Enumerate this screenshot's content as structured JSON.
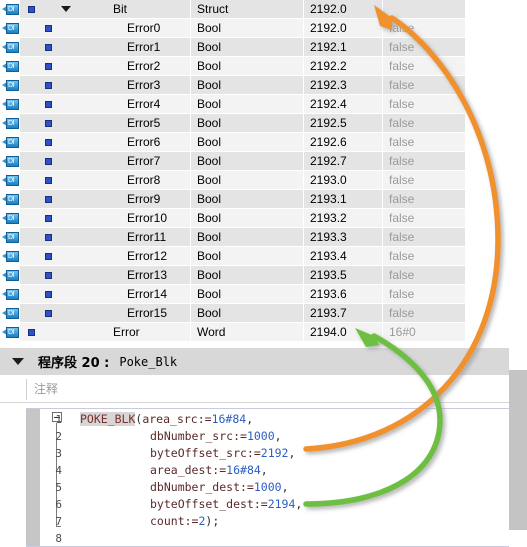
{
  "table": {
    "columns": [
      "icon",
      "marker",
      "name",
      "type",
      "offset",
      "value"
    ],
    "rows": [
      {
        "icon": "tag-icon",
        "level": 1,
        "expander": "collapse-triangle",
        "name": "Bit",
        "type": "Struct",
        "offset": "2192.0",
        "value": "",
        "shade": "norm"
      },
      {
        "icon": "tag-icon",
        "level": 2,
        "name": "Error0",
        "type": "Bool",
        "offset": "2192.0",
        "value": "false",
        "shade": "alt"
      },
      {
        "icon": "tag-icon",
        "level": 2,
        "name": "Error1",
        "type": "Bool",
        "offset": "2192.1",
        "value": "false",
        "shade": "norm"
      },
      {
        "icon": "tag-icon",
        "level": 2,
        "name": "Error2",
        "type": "Bool",
        "offset": "2192.2",
        "value": "false",
        "shade": "alt"
      },
      {
        "icon": "tag-icon",
        "level": 2,
        "name": "Error3",
        "type": "Bool",
        "offset": "2192.3",
        "value": "false",
        "shade": "norm"
      },
      {
        "icon": "tag-icon",
        "level": 2,
        "name": "Error4",
        "type": "Bool",
        "offset": "2192.4",
        "value": "false",
        "shade": "alt"
      },
      {
        "icon": "tag-icon",
        "level": 2,
        "name": "Error5",
        "type": "Bool",
        "offset": "2192.5",
        "value": "false",
        "shade": "norm"
      },
      {
        "icon": "tag-icon",
        "level": 2,
        "name": "Error6",
        "type": "Bool",
        "offset": "2192.6",
        "value": "false",
        "shade": "alt"
      },
      {
        "icon": "tag-icon",
        "level": 2,
        "name": "Error7",
        "type": "Bool",
        "offset": "2192.7",
        "value": "false",
        "shade": "norm"
      },
      {
        "icon": "tag-icon",
        "level": 2,
        "name": "Error8",
        "type": "Bool",
        "offset": "2193.0",
        "value": "false",
        "shade": "alt"
      },
      {
        "icon": "tag-icon",
        "level": 2,
        "name": "Error9",
        "type": "Bool",
        "offset": "2193.1",
        "value": "false",
        "shade": "norm"
      },
      {
        "icon": "tag-icon",
        "level": 2,
        "name": "Error10",
        "type": "Bool",
        "offset": "2193.2",
        "value": "false",
        "shade": "alt"
      },
      {
        "icon": "tag-icon",
        "level": 2,
        "name": "Error11",
        "type": "Bool",
        "offset": "2193.3",
        "value": "false",
        "shade": "norm"
      },
      {
        "icon": "tag-icon",
        "level": 2,
        "name": "Error12",
        "type": "Bool",
        "offset": "2193.4",
        "value": "false",
        "shade": "alt"
      },
      {
        "icon": "tag-icon",
        "level": 2,
        "name": "Error13",
        "type": "Bool",
        "offset": "2193.5",
        "value": "false",
        "shade": "norm"
      },
      {
        "icon": "tag-icon",
        "level": 2,
        "name": "Error14",
        "type": "Bool",
        "offset": "2193.6",
        "value": "false",
        "shade": "alt"
      },
      {
        "icon": "tag-icon",
        "level": 2,
        "name": "Error15",
        "type": "Bool",
        "offset": "2193.7",
        "value": "false",
        "shade": "norm"
      },
      {
        "icon": "tag-icon",
        "level": 1,
        "name": "Error",
        "type": "Word",
        "offset": "2194.0",
        "value": "16#0",
        "shade": "alt"
      }
    ]
  },
  "network": {
    "expander_icon": "collapse-triangle-icon",
    "title": "程序段 20 :",
    "name": "Poke_Blk",
    "comment_placeholder": "注释"
  },
  "code": {
    "lines": [
      {
        "no": "1",
        "segments": [
          {
            "t": "POKE_BLK",
            "c": "kw"
          },
          {
            "t": "(",
            "c": "pun"
          },
          {
            "t": "area_src:=",
            "c": "parm"
          },
          {
            "t": "16#84",
            "c": "num"
          },
          {
            "t": ",",
            "c": "pun"
          }
        ],
        "indent": 0
      },
      {
        "no": "2",
        "segments": [
          {
            "t": "dbNumber_src:=",
            "c": "parm"
          },
          {
            "t": "1000",
            "c": "num"
          },
          {
            "t": ",",
            "c": "pun"
          }
        ],
        "indent": 1
      },
      {
        "no": "3",
        "segments": [
          {
            "t": "byteOffset_src:=",
            "c": "parm"
          },
          {
            "t": "2192",
            "c": "num"
          },
          {
            "t": ",",
            "c": "pun"
          }
        ],
        "indent": 1
      },
      {
        "no": "4",
        "segments": [
          {
            "t": "area_dest:=",
            "c": "parm"
          },
          {
            "t": "16#84",
            "c": "num"
          },
          {
            "t": ",",
            "c": "pun"
          }
        ],
        "indent": 1
      },
      {
        "no": "5",
        "segments": [
          {
            "t": "dbNumber_dest:=",
            "c": "parm"
          },
          {
            "t": "1000",
            "c": "num"
          },
          {
            "t": ",",
            "c": "pun"
          }
        ],
        "indent": 1
      },
      {
        "no": "6",
        "segments": [
          {
            "t": "byteOffset_dest:=",
            "c": "parm"
          },
          {
            "t": "2194",
            "c": "num"
          },
          {
            "t": ",",
            "c": "pun"
          }
        ],
        "indent": 1
      },
      {
        "no": "7",
        "segments": [
          {
            "t": "count:=",
            "c": "parm"
          },
          {
            "t": "2",
            "c": "num"
          },
          {
            "t": ");",
            "c": "pun"
          }
        ],
        "indent": 1
      },
      {
        "no": "8",
        "segments": [],
        "indent": 1
      }
    ]
  },
  "annotations": {
    "source_arrow": {
      "name": "orange-source-arrow",
      "color": "#F0912D",
      "from": "byteOffset_src 2192",
      "to": "offset 2192.0"
    },
    "dest_arrow": {
      "name": "green-dest-arrow",
      "color": "#6CBF40",
      "from": "byteOffset_dest 2194",
      "to": "offset 2194.0"
    }
  },
  "colors": {
    "orange": "#F0912D",
    "green": "#6CBF40",
    "row_alt": "#f3f3f3",
    "row_norm": "#e4e4e4",
    "header_band": "#d8d8d8"
  }
}
